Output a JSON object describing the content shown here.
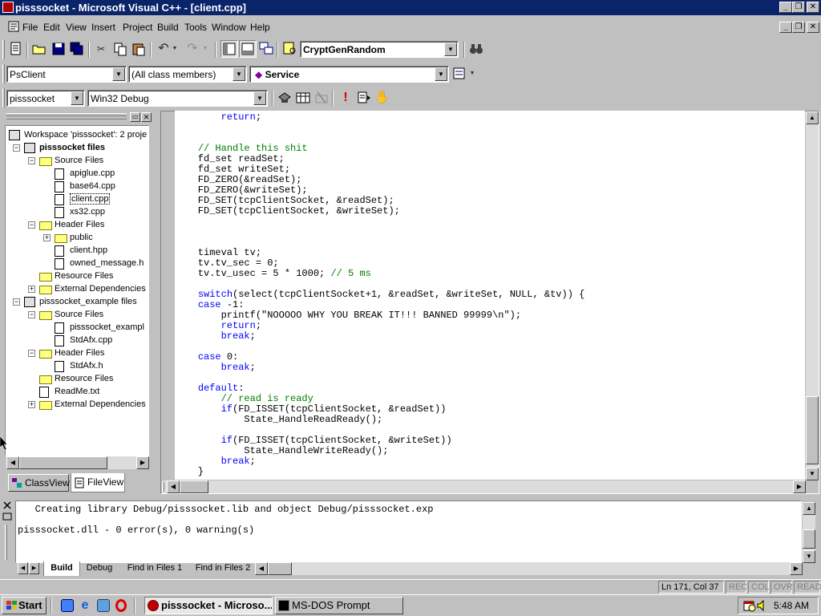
{
  "window": {
    "title": "pisssocket - Microsoft Visual C++ - [client.cpp]",
    "app_icon": "vc-app-icon"
  },
  "menu": [
    "File",
    "Edit",
    "View",
    "Insert",
    "Project",
    "Build",
    "Tools",
    "Window",
    "Help"
  ],
  "toolbar": {
    "find_combo_value": "CryptGenRandom",
    "class_combo": "PsClient",
    "members_combo": "(All class members)",
    "function_combo": "Service",
    "project_combo": "pisssocket",
    "config_combo": "Win32 Debug"
  },
  "workspace": {
    "tree": [
      {
        "label": "Workspace 'pisssocket': 2 proje",
        "level": 0,
        "icon": "workspace-icon"
      },
      {
        "label": "pisssocket files",
        "level": 1,
        "icon": "project-icon",
        "bold": true
      },
      {
        "label": "Source Files",
        "level": 2,
        "icon": "folder-icon"
      },
      {
        "label": "apiglue.cpp",
        "level": 3,
        "icon": "file-icon"
      },
      {
        "label": "base64.cpp",
        "level": 3,
        "icon": "file-icon"
      },
      {
        "label": "client.cpp",
        "level": 3,
        "icon": "file-icon",
        "selected": true
      },
      {
        "label": "xs32.cpp",
        "level": 3,
        "icon": "file-icon"
      },
      {
        "label": "Header Files",
        "level": 2,
        "icon": "folder-icon"
      },
      {
        "label": "public",
        "level": 3,
        "icon": "folder-icon",
        "expandable": true
      },
      {
        "label": "client.hpp",
        "level": 3,
        "icon": "file-icon"
      },
      {
        "label": "owned_message.h",
        "level": 3,
        "icon": "file-icon"
      },
      {
        "label": "Resource Files",
        "level": 2,
        "icon": "folder-icon"
      },
      {
        "label": "External Dependencies",
        "level": 2,
        "icon": "folder-icon",
        "expandable": true
      },
      {
        "label": "pisssocket_example files",
        "level": 1,
        "icon": "project-icon"
      },
      {
        "label": "Source Files",
        "level": 2,
        "icon": "folder-icon"
      },
      {
        "label": "pisssocket_exampl",
        "level": 3,
        "icon": "file-icon"
      },
      {
        "label": "StdAfx.cpp",
        "level": 3,
        "icon": "file-icon"
      },
      {
        "label": "Header Files",
        "level": 2,
        "icon": "folder-icon"
      },
      {
        "label": "StdAfx.h",
        "level": 3,
        "icon": "file-icon"
      },
      {
        "label": "Resource Files",
        "level": 2,
        "icon": "folder-icon"
      },
      {
        "label": "ReadMe.txt",
        "level": 2,
        "icon": "file-icon"
      },
      {
        "label": "External Dependencies",
        "level": 2,
        "icon": "folder-icon",
        "expandable": true
      }
    ],
    "tabs": [
      "ClassView",
      "FileView"
    ],
    "active_tab": "FileView"
  },
  "editor": {
    "lines": [
      "        return;",
      "",
      "",
      "    // Handle this shit",
      "    fd_set readSet;",
      "    fd_set writeSet;",
      "    FD_ZERO(&readSet);",
      "    FD_ZERO(&writeSet);",
      "    FD_SET(tcpClientSocket, &readSet);",
      "    FD_SET(tcpClientSocket, &writeSet);",
      "",
      "",
      "",
      "    timeval tv;",
      "    tv.tv_sec = 0;",
      "    tv.tv_usec = 5 * 1000; // 5 ms",
      "",
      "    switch(select(tcpClientSocket+1, &readSet, &writeSet, NULL, &tv)) {",
      "    case -1:",
      "        printf(\"NOOOOO WHY YOU BREAK IT!!! BANNED 99999\\n\");",
      "        return;",
      "        break;",
      "",
      "    case 0:",
      "        break;",
      "",
      "    default:",
      "        // read is ready",
      "        if(FD_ISSET(tcpClientSocket, &readSet))",
      "            State_HandleReadReady();",
      "",
      "        if(FD_ISSET(tcpClientSocket, &writeSet))",
      "            State_HandleWriteReady();",
      "        break;",
      "    }"
    ]
  },
  "output": {
    "lines": [
      "   Creating library Debug/pisssocket.lib and object Debug/pisssocket.exp",
      "",
      "pisssocket.dll - 0 error(s), 0 warning(s)"
    ],
    "tabs": [
      "Build",
      "Debug",
      "Find in Files 1",
      "Find in Files 2"
    ],
    "active_tab": "Build"
  },
  "statusbar": {
    "position": "Ln 171, Col 37",
    "indicators": [
      "REC",
      "COL",
      "OVR",
      "READ"
    ]
  },
  "taskbar": {
    "start_label": "Start",
    "tasks": [
      "pisssocket - Microso...",
      "MS-DOS Prompt"
    ],
    "active_task": "pisssocket - Microso...",
    "clock": "5:48 AM"
  },
  "colors": {
    "titlebar": "#0a246a",
    "keyword": "#0000ff",
    "comment": "#008000",
    "face": "#c0c0c0"
  }
}
